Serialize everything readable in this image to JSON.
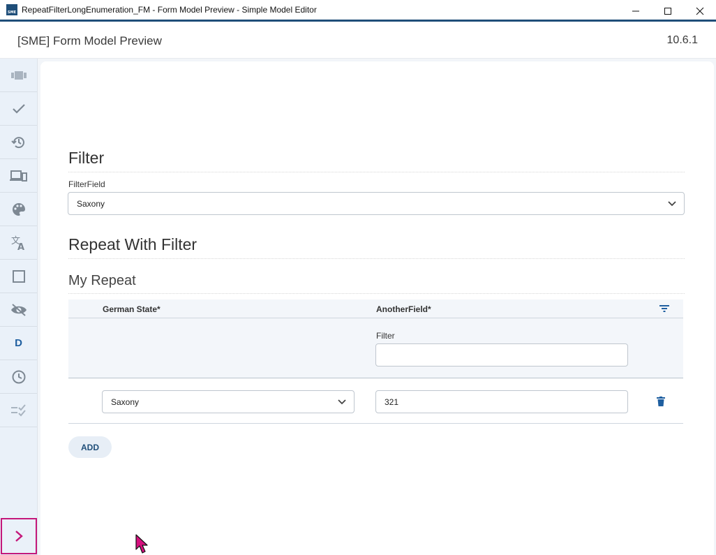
{
  "window": {
    "title": "RepeatFilterLongEnumeration_FM - Form Model Preview - Simple Model Editor",
    "icon_text": "SME",
    "controls": [
      "minimize-icon",
      "maximize-icon",
      "close-icon"
    ]
  },
  "header": {
    "title": "[SME] Form Model Preview",
    "version": "10.6.1"
  },
  "sidebar": {
    "items": [
      {
        "icon": "panels-icon"
      },
      {
        "icon": "check-icon"
      },
      {
        "icon": "history-icon"
      },
      {
        "icon": "devices-icon"
      },
      {
        "icon": "palette-icon"
      },
      {
        "icon": "translate-icon"
      },
      {
        "icon": "square-icon"
      },
      {
        "icon": "visibility-off-icon"
      },
      {
        "icon": "d-icon",
        "label": "D"
      },
      {
        "icon": "clock-icon"
      },
      {
        "icon": "checklist-icon"
      }
    ],
    "expand_icon": "chevron-right-icon"
  },
  "form": {
    "filter_section_title": "Filter",
    "filter_field_label": "FilterField",
    "filter_field_value": "Saxony",
    "repeat_section_title": "Repeat With Filter",
    "repeat_title": "My Repeat",
    "columns": [
      "German State*",
      "AnotherField*"
    ],
    "filter_label": "Filter",
    "filter_input_value": "",
    "rows": [
      {
        "german_state": "Saxony",
        "another_field": "321"
      }
    ],
    "add_label": "ADD"
  },
  "colors": {
    "accent": "#1f4e79",
    "sidebar_bg": "#eaf1f9",
    "highlight": "#c4177a"
  }
}
